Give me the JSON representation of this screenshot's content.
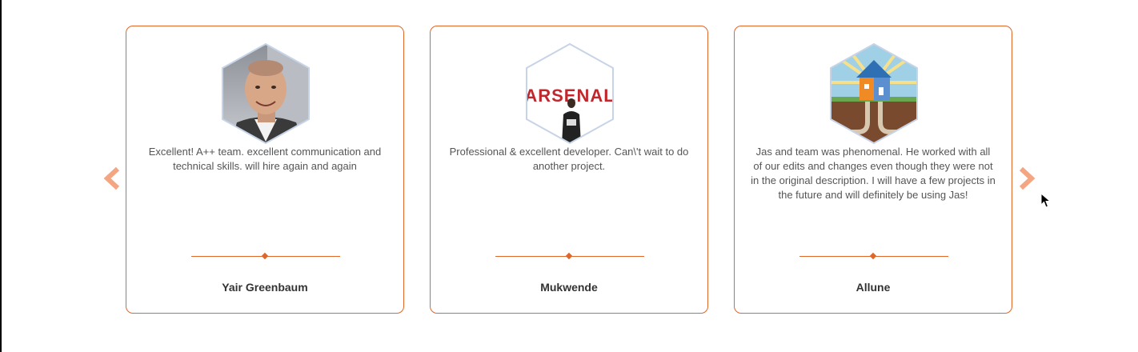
{
  "carousel": {
    "accent_color": "#e0662a",
    "arrow_color": "#f4a582",
    "prev_icon": "chevron-left-icon",
    "next_icon": "chevron-right-icon",
    "testimonials": [
      {
        "quote": "Excellent! A++ team. excellent communication and technical skills. will hire again and again",
        "name": "Yair Greenbaum",
        "avatar": "person-photo"
      },
      {
        "quote": "Professional & excellent developer. Can\\'t wait to do another project.",
        "name": "Mukwende",
        "avatar_text": "ARSENAL"
      },
      {
        "quote": "Jas and team was phenomenal. He worked with all of our edits and changes even though they were not in the original description. I will have a few projects in the future and will definitely be using Jas!",
        "name": "Allune",
        "avatar": "house-plumbing-logo"
      }
    ]
  }
}
